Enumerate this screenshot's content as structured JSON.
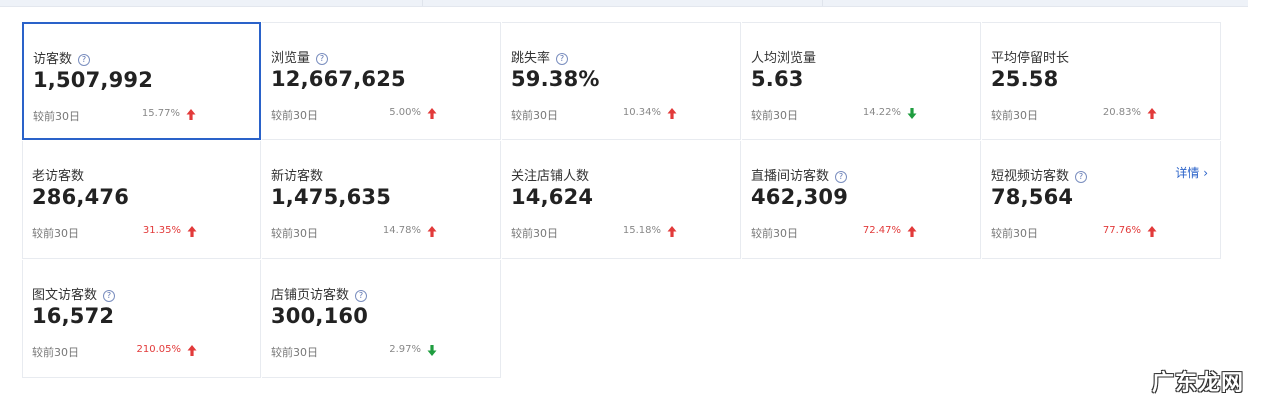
{
  "compare_label": "较前30日",
  "detail_link": "详情",
  "watermark": "广东龙网",
  "colors": {
    "up": "#e23a3a",
    "down": "#1f9d3f",
    "selected_border": "#2a62c9"
  },
  "metrics": [
    {
      "label": "访客数",
      "has_help": true,
      "value": "1,507,992",
      "pct": "15.77%",
      "trend": "up",
      "pct_red": false,
      "selected": true
    },
    {
      "label": "浏览量",
      "has_help": true,
      "value": "12,667,625",
      "pct": "5.00%",
      "trend": "up",
      "pct_red": false
    },
    {
      "label": "跳失率",
      "has_help": true,
      "value": "59.38%",
      "pct": "10.34%",
      "trend": "up",
      "pct_red": false
    },
    {
      "label": "人均浏览量",
      "has_help": false,
      "value": "5.63",
      "pct": "14.22%",
      "trend": "down",
      "pct_red": false
    },
    {
      "label": "平均停留时长",
      "has_help": false,
      "value": "25.58",
      "pct": "20.83%",
      "trend": "up",
      "pct_red": false
    },
    {
      "label": "老访客数",
      "has_help": false,
      "value": "286,476",
      "pct": "31.35%",
      "trend": "up",
      "pct_red": true
    },
    {
      "label": "新访客数",
      "has_help": false,
      "value": "1,475,635",
      "pct": "14.78%",
      "trend": "up",
      "pct_red": false
    },
    {
      "label": "关注店铺人数",
      "has_help": false,
      "value": "14,624",
      "pct": "15.18%",
      "trend": "up",
      "pct_red": false
    },
    {
      "label": "直播间访客数",
      "has_help": true,
      "value": "462,309",
      "pct": "72.47%",
      "trend": "up",
      "pct_red": true
    },
    {
      "label": "短视频访客数",
      "has_help": true,
      "value": "78,564",
      "pct": "77.76%",
      "trend": "up",
      "pct_red": true,
      "detail": true
    },
    {
      "label": "图文访客数",
      "has_help": true,
      "value": "16,572",
      "pct": "210.05%",
      "trend": "up",
      "pct_red": true
    },
    {
      "label": "店铺页访客数",
      "has_help": true,
      "value": "300,160",
      "pct": "2.97%",
      "trend": "down",
      "pct_red": false
    }
  ]
}
